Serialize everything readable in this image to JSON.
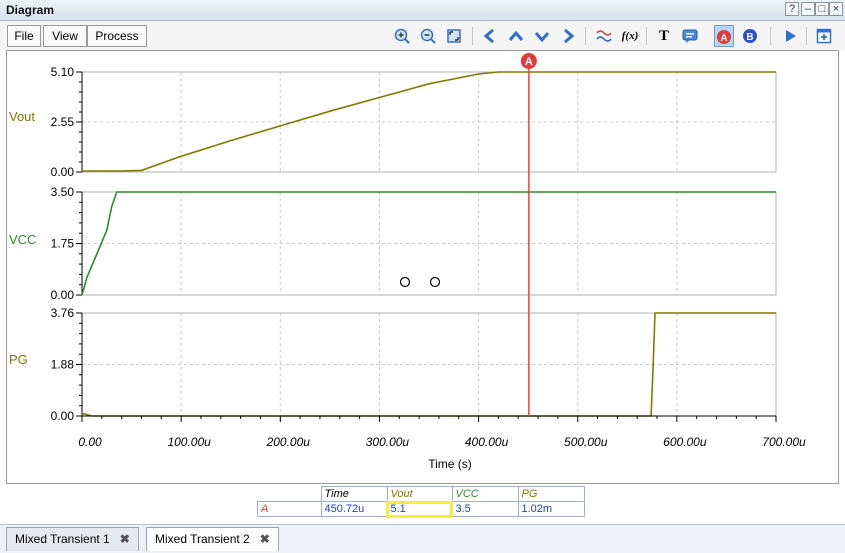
{
  "window": {
    "title": "Diagram",
    "controls": {
      "help": "?",
      "minimize": "–",
      "maximize": "□",
      "close": "×"
    }
  },
  "menu": [
    "File",
    "View",
    "Process"
  ],
  "toolbar": {
    "icons": [
      "zoom-in-icon",
      "zoom-out-icon",
      "fit-icon",
      "cursor-left-icon",
      "cursor-up-icon",
      "cursor-down-icon",
      "cursor-right-icon",
      "waveform-icon",
      "formula-icon",
      "text-icon",
      "annotation-icon",
      "cursor-a-icon",
      "cursor-b-icon",
      "run-icon",
      "add-diagram-icon"
    ],
    "formula_label": "f(x)",
    "text_label": "T",
    "cursor_a_label": "A",
    "cursor_b_label": "B"
  },
  "colors": {
    "vout": "#807a00",
    "vcc": "#2e8b2e",
    "pg": "#807a00",
    "cursor": "#ff3b3b",
    "grid": "#c8c8c8"
  },
  "chart_data": [
    {
      "type": "line",
      "xlabel": "Time (s)",
      "xlim": [
        0,
        700
      ],
      "x_unit": "u",
      "ylabel": "Vout",
      "ylim": [
        0,
        5.1
      ],
      "yticks": [
        "0.00",
        "2.55",
        "5.10"
      ],
      "series": [
        {
          "name": "Vout",
          "x": [
            0,
            40,
            60,
            100,
            150,
            200,
            250,
            300,
            350,
            400,
            420,
            440,
            450.72,
            500,
            550,
            600,
            650,
            700
          ],
          "y": [
            0.05,
            0.05,
            0.08,
            0.8,
            1.6,
            2.35,
            3.1,
            3.8,
            4.5,
            5.0,
            5.1,
            5.1,
            5.1,
            5.1,
            5.1,
            5.1,
            5.1,
            5.1
          ]
        }
      ]
    },
    {
      "type": "line",
      "xlim": [
        0,
        700
      ],
      "ylabel": "VCC",
      "ylim": [
        0,
        3.5
      ],
      "yticks": [
        "0.00",
        "1.75",
        "3.50"
      ],
      "series": [
        {
          "name": "VCC",
          "x": [
            0,
            5,
            15,
            25,
            30,
            35,
            100,
            200,
            300,
            400,
            500,
            600,
            700
          ],
          "y": [
            0,
            0.6,
            1.4,
            2.2,
            3.0,
            3.5,
            3.5,
            3.5,
            3.5,
            3.5,
            3.5,
            3.5,
            3.5
          ]
        }
      ]
    },
    {
      "type": "line",
      "xlim": [
        0,
        700
      ],
      "ylabel": "PG",
      "ylim": [
        0,
        3.76
      ],
      "yticks": [
        "0.00",
        "1.88",
        "3.76"
      ],
      "xticks": [
        "0.00",
        "100.00u",
        "200.00u",
        "300.00u",
        "400.00u",
        "500.00u",
        "600.00u",
        "700.00u"
      ],
      "series": [
        {
          "name": "PG",
          "x": [
            0,
            5,
            10,
            100,
            200,
            300,
            400,
            500,
            574,
            576,
            578,
            580,
            700
          ],
          "y": [
            0.1,
            0.05,
            0.0,
            0.0,
            0.0,
            0.0,
            0.0,
            0.0,
            0.0,
            1.8,
            3.76,
            3.76,
            3.76
          ]
        }
      ]
    }
  ],
  "cursor": {
    "label": "A",
    "x": 450.72
  },
  "readout": {
    "headers": [
      "Time",
      "Vout",
      "VCC",
      "PG"
    ],
    "row": {
      "cursor": "A",
      "time": "450.72u",
      "vout": "5.1",
      "vcc": "3.5",
      "pg": "1.02m"
    }
  },
  "tabs": [
    {
      "label": "Mixed Transient 1",
      "active": false
    },
    {
      "label": "Mixed Transient 2",
      "active": true
    }
  ]
}
